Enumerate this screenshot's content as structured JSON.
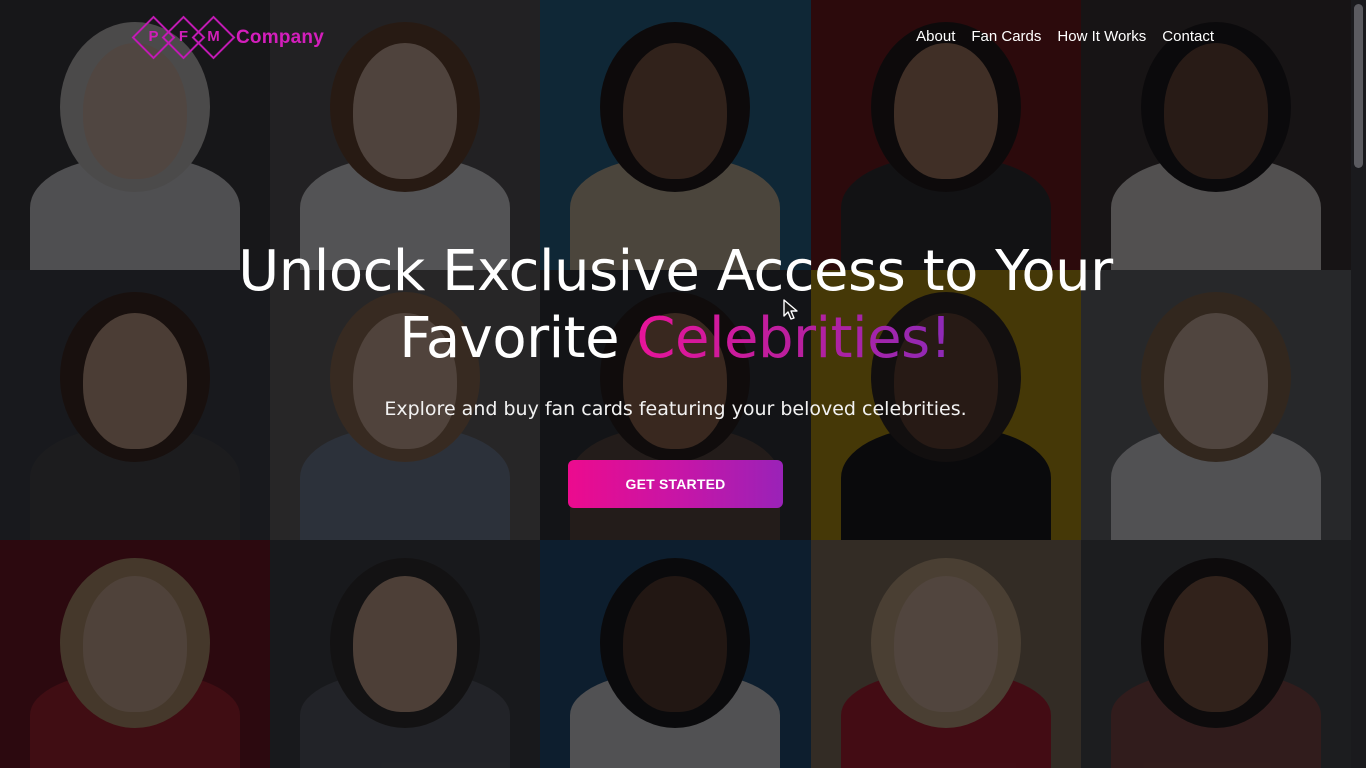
{
  "brand": {
    "logo_letters": [
      "P",
      "F",
      "M"
    ],
    "name": "Company",
    "color": "#d41ebc"
  },
  "nav": {
    "items": [
      {
        "label": "About"
      },
      {
        "label": "Fan Cards"
      },
      {
        "label": "How It Works"
      },
      {
        "label": "Contact"
      }
    ]
  },
  "hero": {
    "title_line1": "Unlock Exclusive Access to Your",
    "title_line2_plain": "Favorite",
    "title_line2_accent": "Celebrities!",
    "subtitle": "Explore and buy fan cards featuring your beloved celebrities.",
    "cta_label": "GET STARTED",
    "accent_gradient": [
      "#e8149a",
      "#8d2ab8"
    ]
  },
  "background": {
    "tiles": [
      {
        "bg": "#3a3838",
        "hair": "#d9d6d0",
        "skin": "#e8c9b4",
        "shirt": "#e6e6e6"
      },
      {
        "bg": "#5c5958",
        "hair": "#6b4226",
        "skin": "#e7c2a8",
        "shirt": "#f2f2f2"
      },
      {
        "bg": "#1f6b93",
        "hair": "#1a120d",
        "skin": "#8a5a3e",
        "shirt": "#d9c7a6"
      },
      {
        "bg": "#7a1212",
        "hair": "#1b120e",
        "skin": "#b98361",
        "shirt": "#2a2a2a"
      },
      {
        "bg": "#3a2f2c",
        "hair": "#141010",
        "skin": "#6e4630",
        "shirt": "#efeae4"
      },
      {
        "bg": "#3b3f44",
        "hair": "#3b2416",
        "skin": "#d9ad8e",
        "shirt": "#4a4a4a"
      },
      {
        "bg": "#6b6663",
        "hair": "#9c7552",
        "skin": "#e8c2a4",
        "shirt": "#7b8aa0"
      },
      {
        "bg": "#2c3032",
        "hair": "#231812",
        "skin": "#a16d4d",
        "shirt": "#5e4a3c"
      },
      {
        "bg": "#c8a000",
        "hair": "#2b1f1a",
        "skin": "#6a432c",
        "shirt": "#111111"
      },
      {
        "bg": "#6a6d6f",
        "hair": "#8b6a4a",
        "skin": "#e9c8ad",
        "shirt": "#ececec"
      },
      {
        "bg": "#7b0f1a",
        "hair": "#c8a070",
        "skin": "#e5bfa0",
        "shirt": "#b81a26"
      },
      {
        "bg": "#3d3f41",
        "hair": "#2e2a26",
        "skin": "#e0b596",
        "shirt": "#5b5f66"
      },
      {
        "bg": "#1b4f7a",
        "hair": "#121212",
        "skin": "#5b3a28",
        "shirt": "#ececec"
      },
      {
        "bg": "#8e7a5e",
        "hair": "#d6b58a",
        "skin": "#ecc8aa",
        "shirt": "#c0182b"
      },
      {
        "bg": "#4a4b4c",
        "hair": "#1a1412",
        "skin": "#8a5c3e",
        "shirt": "#8a4a42"
      }
    ]
  }
}
